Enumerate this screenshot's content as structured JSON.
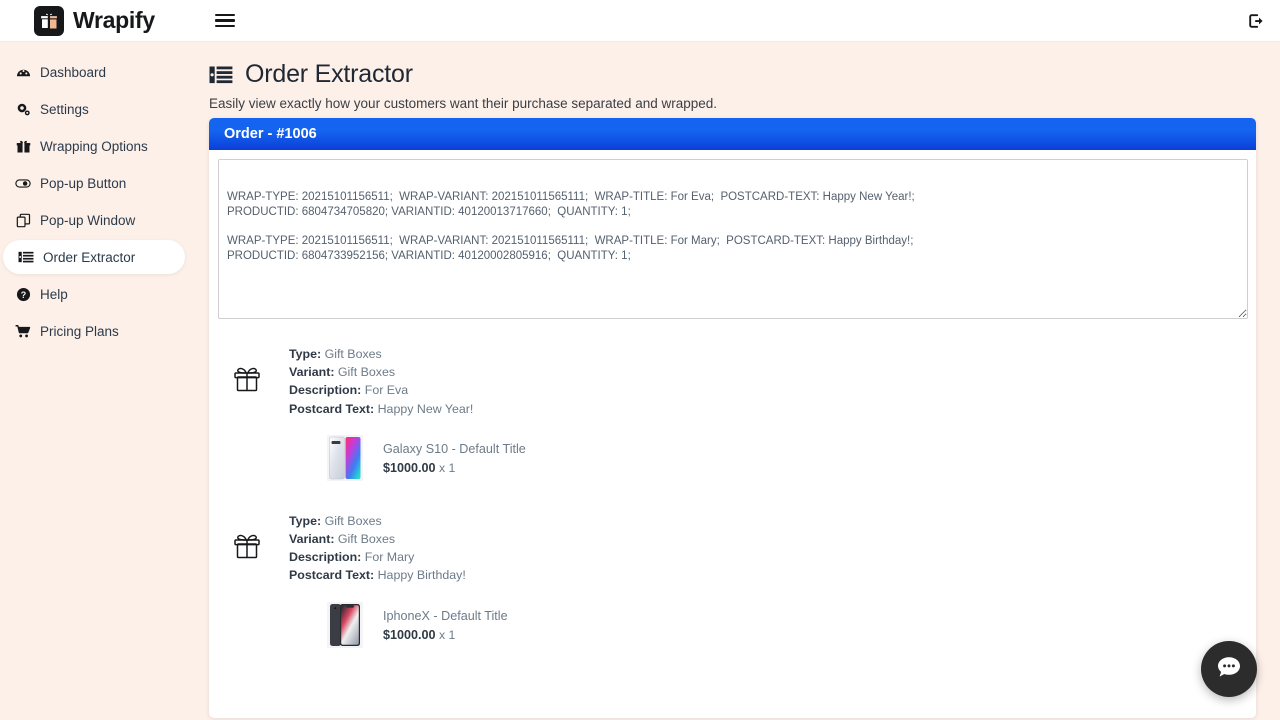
{
  "brand": {
    "name": "Wrapify",
    "logo_icon": "gift-box-logo-icon"
  },
  "topnav": {
    "menu_toggle_icon": "hamburger-menu-icon",
    "logout_icon": "logout-icon"
  },
  "sidebar": {
    "items": [
      {
        "label": "Dashboard",
        "icon": "dashboard-gauge-icon",
        "active": false
      },
      {
        "label": "Settings",
        "icon": "gear-icon",
        "active": false
      },
      {
        "label": "Wrapping Options",
        "icon": "gift-icon",
        "active": false
      },
      {
        "label": "Pop-up Button",
        "icon": "toggle-button-icon",
        "active": false
      },
      {
        "label": "Pop-up Window",
        "icon": "windows-copy-icon",
        "active": false
      },
      {
        "label": "Order Extractor",
        "icon": "list-extract-icon",
        "active": true
      },
      {
        "label": "Help",
        "icon": "question-circle-icon",
        "active": false
      },
      {
        "label": "Pricing Plans",
        "icon": "shopping-cart-icon",
        "active": false
      }
    ]
  },
  "page": {
    "icon": "list-extract-icon",
    "title": "Order Extractor",
    "subtitle": "Easily view exactly how your customers want their purchase separated and wrapped."
  },
  "card": {
    "header": "Order - #1006",
    "extract_textarea": {
      "value": "WRAP-TYPE: 20215101156511;  WRAP-VARIANT: 202151011565111;  WRAP-TITLE: For Eva;  POSTCARD-TEXT: Happy New Year!;\nPRODUCTID: 6804734705820; VARIANTID: 40120013717660;  QUANTITY: 1;\n\nWRAP-TYPE: 20215101156511;  WRAP-VARIANT: 202151011565111;  WRAP-TITLE: For Mary;  POSTCARD-TEXT: Happy Birthday!;\nPRODUCTID: 6804733952156; VARIANTID: 40120002805916;  QUANTITY: 1;",
      "placeholder": ""
    }
  },
  "order_items": [
    {
      "wrap_icon": "gift-box-icon",
      "labels": {
        "type": "Type:",
        "variant": "Variant:",
        "description": "Description:",
        "postcard": "Postcard Text:"
      },
      "type": "Gift Boxes",
      "variant": "Gift Boxes",
      "description": "For Eva",
      "postcard_text": "Happy New Year!",
      "product": {
        "thumb_icon": "galaxy-s10-phone-thumbnail",
        "name": "Galaxy S10 - Default Title",
        "price": "$1000.00",
        "quantity": "x 1"
      }
    },
    {
      "wrap_icon": "gift-box-icon",
      "labels": {
        "type": "Type:",
        "variant": "Variant:",
        "description": "Description:",
        "postcard": "Postcard Text:"
      },
      "type": "Gift Boxes",
      "variant": "Gift Boxes",
      "description": "For Mary",
      "postcard_text": "Happy Birthday!",
      "product": {
        "thumb_icon": "iphonex-phone-thumbnail",
        "name": "IphoneX - Default Title",
        "price": "$1000.00",
        "quantity": "x 1"
      }
    }
  ],
  "chat_widget": {
    "icon": "chat-bubble-icon"
  },
  "colors": {
    "sidebar_bg": "#fdf0e9",
    "card_header_blue": "#1464f0",
    "text_dark": "#2f3a46",
    "text_muted": "#6d7b88",
    "chat_fab": "#2c2c2c"
  }
}
